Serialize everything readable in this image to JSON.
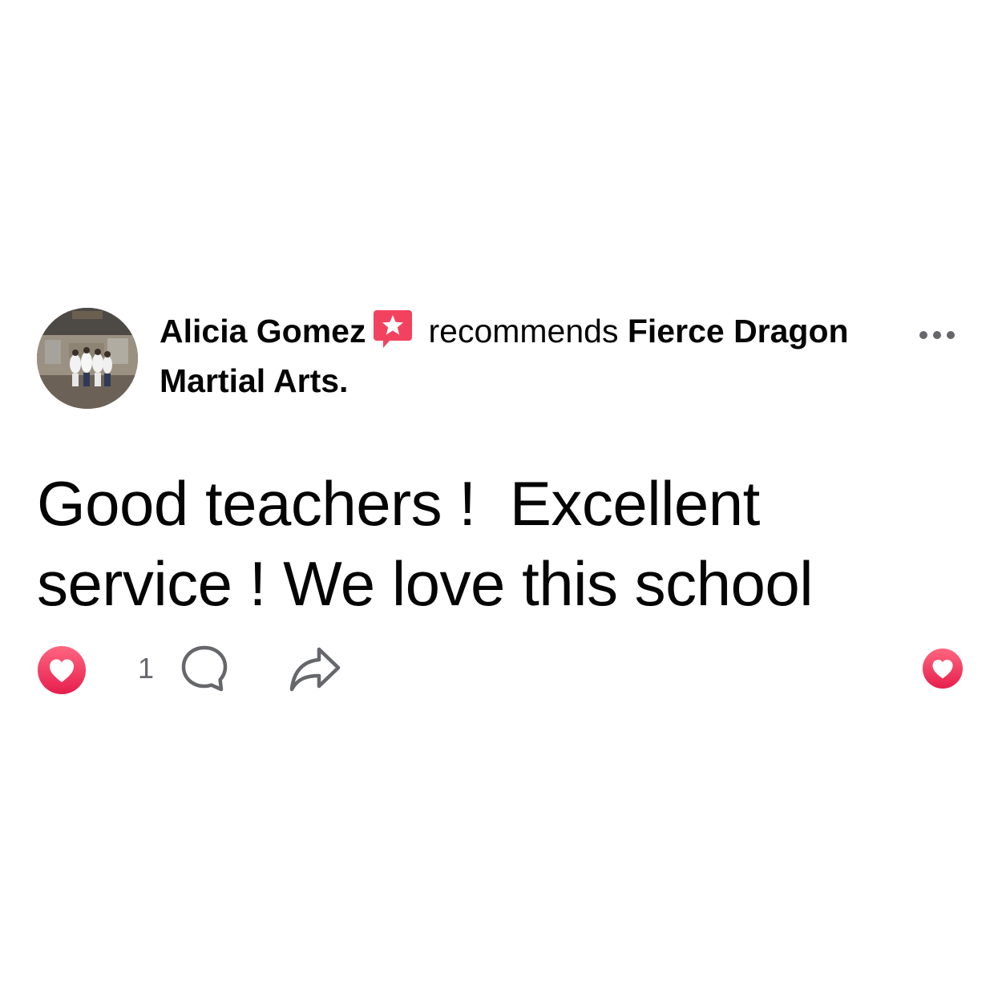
{
  "post": {
    "author_name": "Alicia Gomez",
    "action_text": "recommends",
    "page_name": "Fierce Dragon Martial Arts.",
    "review_text": "Good teachers !  Excellent service ! We love this school",
    "reaction_count": "1"
  },
  "icons": {
    "recommend_badge": "recommendation-star-icon",
    "more": "more-options-icon",
    "reaction": "love-reaction-icon",
    "comment": "comment-icon",
    "share": "share-icon",
    "like": "love-icon"
  },
  "colors": {
    "reaction_red": "#f33e58",
    "badge_pink": "#f3425f",
    "icon_gray": "#65676b",
    "text": "#050505"
  }
}
